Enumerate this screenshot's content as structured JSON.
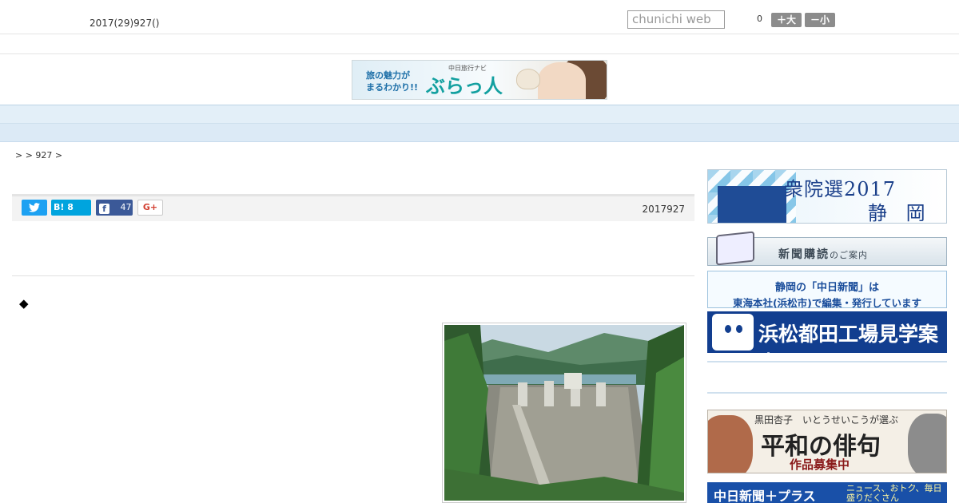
{
  "header": {
    "date": "2017(29)927()",
    "search_placeholder": "chunichi web",
    "count": "0",
    "font_bigger": "＋大",
    "font_smaller": "－小"
  },
  "banner": {
    "line1": "旅の魅力が",
    "line2": "まるわかり!!",
    "small": "中日旅行ナビ",
    "brand": "ぶらっ人"
  },
  "nav": {
    "items": [
      "",
      "",
      "",
      "",
      "",
      "",
      "",
      "",
      ""
    ]
  },
  "breadcrumb": ">  > 927 >",
  "share": {
    "hatena": "B! 8",
    "facebook": "47",
    "gplus": "G+"
  },
  "article": {
    "date": "2017927",
    "bullet": "◆"
  },
  "sidebar": {
    "election_title": "衆院選2017",
    "election_region": "静 岡",
    "subscription_main": "新聞購読",
    "subscription_sub": "のご案内",
    "notice_line1": "静岡の「中日新聞」は",
    "notice_line2": "東海本社(浜松市)で編集・発行しています",
    "factory": "浜松都田工場見学案内",
    "haiku_top": "黒田杏子　いとうせいこうが選ぶ",
    "haiku_title": "平和の俳句",
    "haiku_sub": "作品募集中",
    "plus_title": "中日新聞＋プラス",
    "plus_sub": "ニュース、おトク、毎日盛りだくさん"
  },
  "colors": {
    "nav_bg": "#e3eff8",
    "twitter": "#1da1f2",
    "hatena": "#00a4de",
    "facebook": "#3b5998"
  }
}
